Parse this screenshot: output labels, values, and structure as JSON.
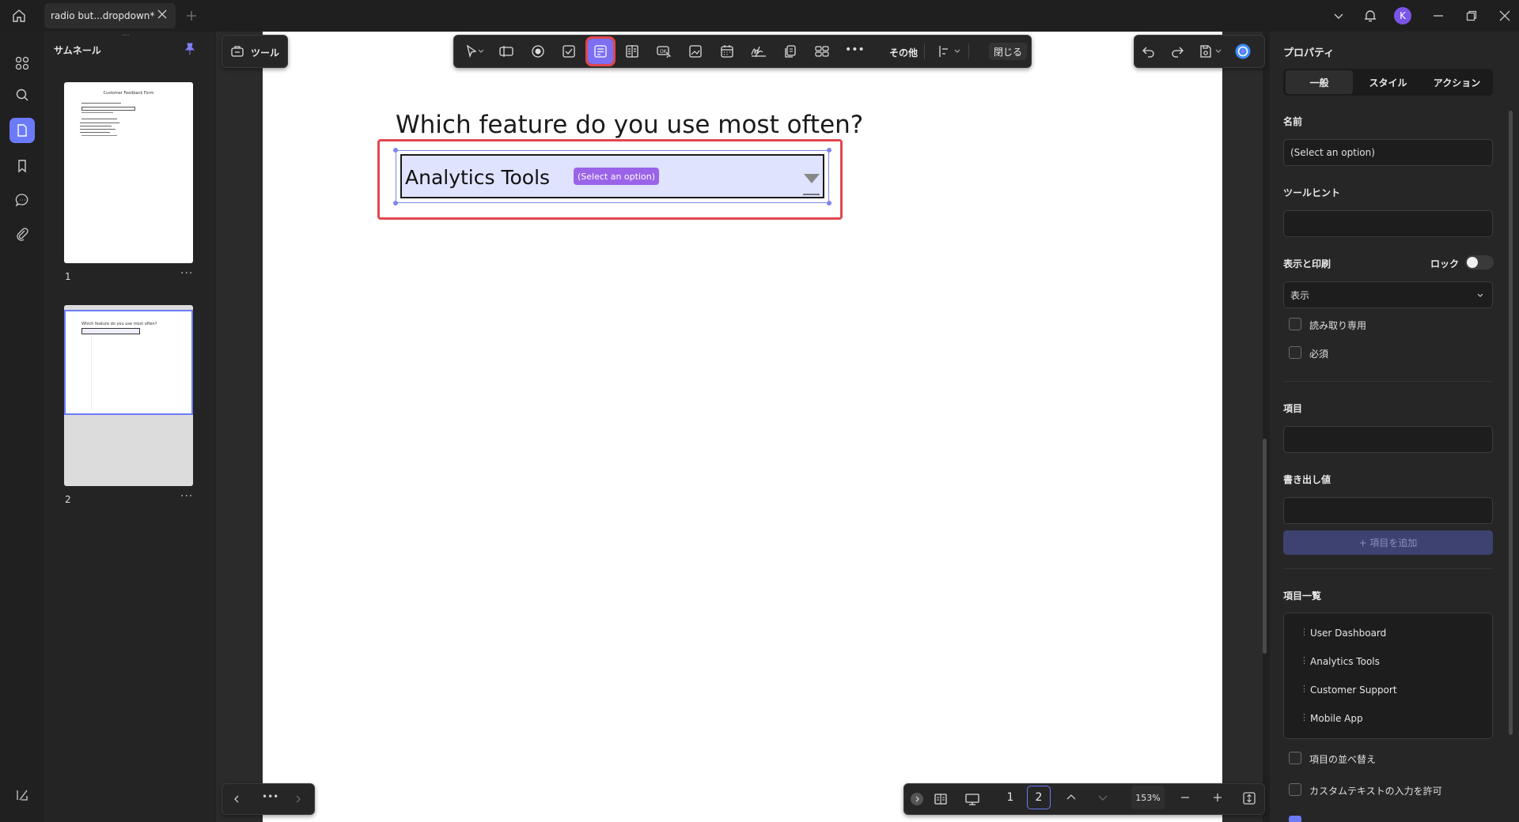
{
  "window": {
    "tab_title": "radio but...dropdown*",
    "avatar_letter": "K"
  },
  "thumbnails": {
    "title": "サムネール",
    "pages": [
      {
        "num": "1",
        "heading": "Customer Feedback Form"
      },
      {
        "num": "2",
        "heading": "Which feature do you use most often?"
      }
    ],
    "more": "···"
  },
  "toolbar": {
    "tools_label": "ツール",
    "more_label": "その他",
    "close_label": "閉じる"
  },
  "canvas": {
    "question": "Which feature do you use most often?",
    "field_value": "Analytics Tools",
    "field_name_tag": "(Select an option)"
  },
  "properties": {
    "title": "プロパティ",
    "tabs": [
      "一般",
      "スタイル",
      "アクション"
    ],
    "name_label": "名前",
    "name_value": "(Select an option)",
    "tooltip_label": "ツールヒント",
    "tooltip_value": "",
    "display_print_label": "表示と印刷",
    "lock_label": "ロック",
    "display_value": "表示",
    "readonly_label": "読み取り専用",
    "required_label": "必須",
    "item_label": "項目",
    "item_value": "",
    "export_label": "書き出し値",
    "export_value": "",
    "add_item_button": "+ 項目を追加",
    "item_list_label": "項目一覧",
    "items": [
      "User Dashboard",
      "Analytics Tools",
      "Customer Support",
      "Mobile App"
    ],
    "sort_label": "項目の並べ替え",
    "custom_text_label": "カスタムテキストの入力を許可"
  },
  "bottombar": {
    "page_1": "1",
    "page_2": "2",
    "zoom": "153%"
  },
  "colors": {
    "accent": "#6b7bf7",
    "highlight_red": "#e0484e",
    "field_fill": "#dfe3fe",
    "name_tag": "#9b63e8"
  }
}
